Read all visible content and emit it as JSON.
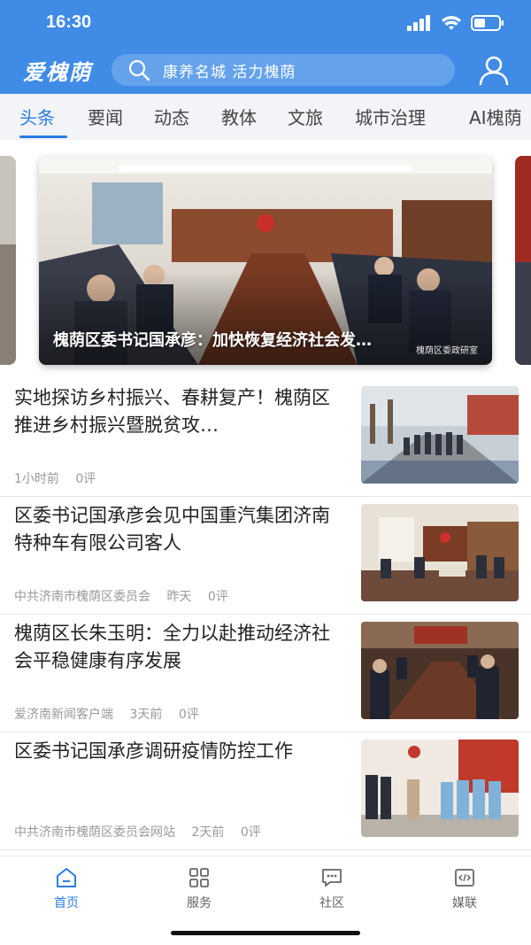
{
  "status_bar": {
    "time": "16:30"
  },
  "header": {
    "app_name": "爱槐荫",
    "search_placeholder": "康养名城 活力槐荫"
  },
  "tabs": [
    {
      "label": "头条",
      "active": true
    },
    {
      "label": "要闻"
    },
    {
      "label": "动态"
    },
    {
      "label": "教体"
    },
    {
      "label": "文旅"
    },
    {
      "label": "城市治理"
    },
    {
      "label": "AI槐荫"
    }
  ],
  "carousel": {
    "caption": "槐荫区委书记国承彦：加快恢复经济社会发…",
    "watermark": "槐荫区委政研室"
  },
  "news": [
    {
      "title": "实地探访乡村振兴、春耕复产！槐荫区推进乡村振兴暨脱贫攻…",
      "source": "",
      "time": "1小时前",
      "comments": "0评"
    },
    {
      "title": "区委书记国承彦会见中国重汽集团济南特种车有限公司客人",
      "source": "中共济南市槐荫区委员会",
      "time": "昨天",
      "comments": "0评"
    },
    {
      "title": "槐荫区长朱玉明：全力以赴推动经济社会平稳健康有序发展",
      "source": "爱济南新闻客户端",
      "time": "3天前",
      "comments": "0评"
    },
    {
      "title": "区委书记国承彦调研疫情防控工作",
      "source": "中共济南市槐荫区委员会网站",
      "time": "2天前",
      "comments": "0评"
    }
  ],
  "bottom_nav": [
    {
      "label": "首页",
      "icon": "home-icon",
      "active": true
    },
    {
      "label": "服务",
      "icon": "grid-icon"
    },
    {
      "label": "社区",
      "icon": "chat-icon"
    },
    {
      "label": "媒联",
      "icon": "code-icon"
    }
  ],
  "colors": {
    "brand": "#3f8be6",
    "accent": "#2c7be5"
  }
}
